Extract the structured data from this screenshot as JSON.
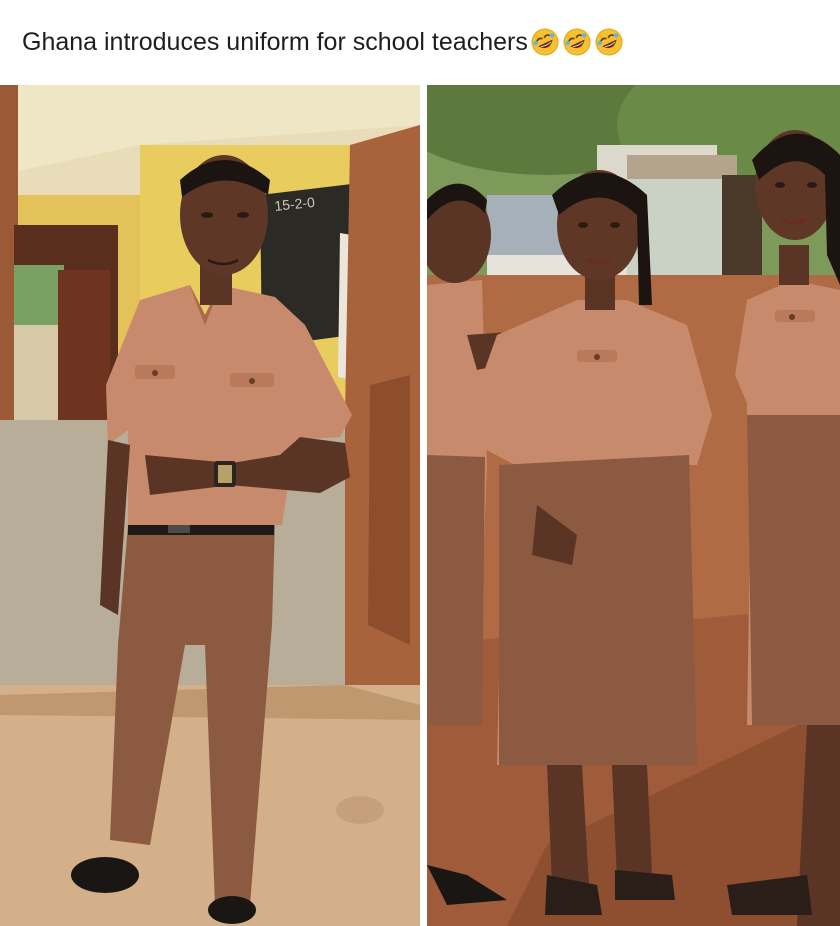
{
  "post": {
    "caption": "Ghana introduces uniform for school teachers",
    "caption_emojis": [
      "rolling-on-floor-laughing-icon",
      "rolling-on-floor-laughing-icon",
      "rolling-on-floor-laughing-icon"
    ]
  },
  "photos": [
    {
      "name": "male-teacher-photo",
      "handwriting": "15-2-0"
    },
    {
      "name": "female-teachers-photo"
    }
  ],
  "colors": {
    "uniform_shirt": "#c88a6c",
    "uniform_bottom": "#8c5a40",
    "soil": "#b06a44"
  }
}
